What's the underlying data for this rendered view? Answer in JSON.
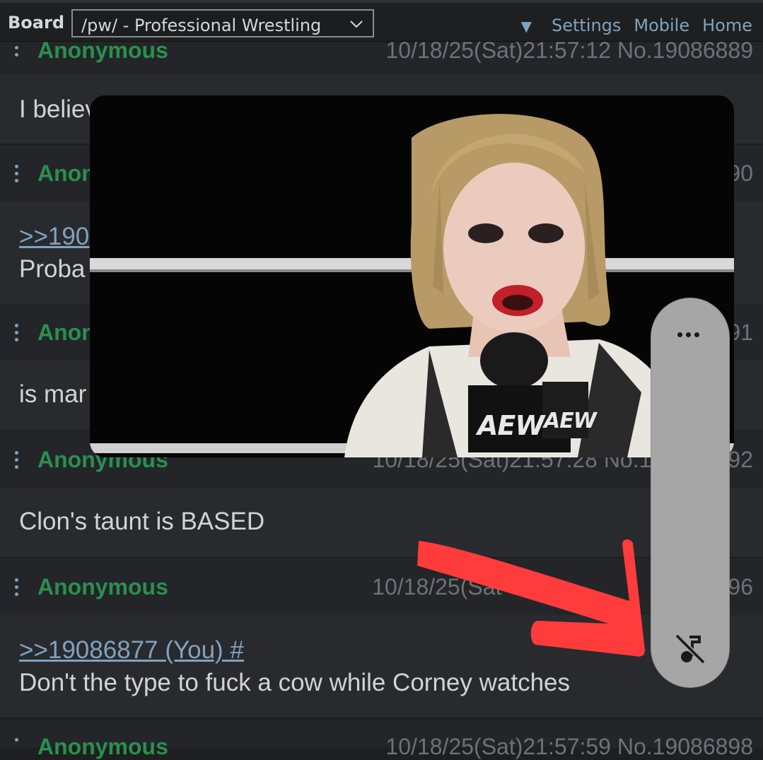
{
  "nav": {
    "board_label": "Board",
    "board_selected": "/pw/ - Professional Wrestling",
    "toggle": "▼",
    "links": [
      "Settings",
      "Mobile",
      "Home"
    ]
  },
  "posts": [
    {
      "name": "Anonymous",
      "meta": "10/18/25(Sat)21:57:12 No.19086889",
      "lines": [
        "I believe"
      ]
    },
    {
      "name": "Anonymous",
      "meta": "90",
      "quote": ">>190",
      "lines": [
        "Proba"
      ]
    },
    {
      "name": "Anonymous",
      "meta": "91",
      "lines": [
        "is mar"
      ]
    },
    {
      "name": "Anonymous",
      "meta": "10/18/25(Sat)21:57:28 No.1",
      "meta_tail": "92",
      "lines": [
        "Clon's taunt is BASED"
      ]
    },
    {
      "name": "Anonymous",
      "meta": "10/18/25(Sat",
      "meta_tail": "96",
      "quote": ">>19086877 (You) #",
      "lines": [
        "Don't the type to fuck a cow while Corney watches"
      ]
    },
    {
      "name": "Anonymous",
      "meta": "10/18/25(Sat)21:57:59 No.19086898"
    }
  ],
  "video": {
    "logo_text_1": "AEW",
    "logo_text_2": "AEW"
  },
  "player": {
    "more_icon": "more-horizontal-icon",
    "mute_icon": "music-off-icon"
  },
  "colors": {
    "background": "#1d1f21",
    "post_header": "#232528",
    "post_body": "#282a2e",
    "name_green": "#2b8f4f",
    "link_blue": "#81a2be",
    "annotation_red": "#ff3b3b",
    "pill_gray": "#a6a6a6"
  }
}
